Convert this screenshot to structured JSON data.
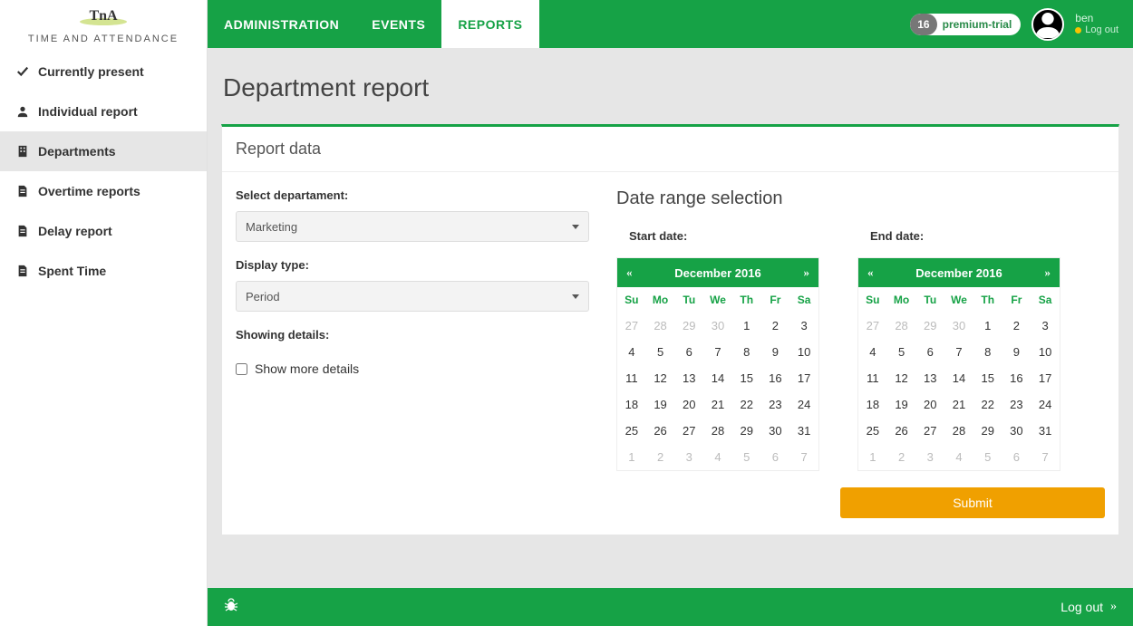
{
  "logo": {
    "main": "TnA",
    "sub": "TIME AND ATTENDANCE"
  },
  "sidebar": {
    "items": [
      {
        "label": "Currently present"
      },
      {
        "label": "Individual report"
      },
      {
        "label": "Departments"
      },
      {
        "label": "Overtime reports"
      },
      {
        "label": "Delay report"
      },
      {
        "label": "Spent Time"
      }
    ]
  },
  "topbar": {
    "tabs": [
      {
        "label": "ADMINISTRATION"
      },
      {
        "label": "EVENTS"
      },
      {
        "label": "REPORTS"
      }
    ],
    "badge_number": "16",
    "badge_label": "premium-trial",
    "username": "ben",
    "logout_label": "Log out"
  },
  "page": {
    "title": "Department report"
  },
  "panel": {
    "title": "Report data",
    "dept_label": "Select departament:",
    "dept_value": "Marketing",
    "display_label": "Display type:",
    "display_value": "Period",
    "details_label": "Showing details:",
    "checkbox_label": "Show more details",
    "date_section_title": "Date range selection",
    "start_label": "Start date:",
    "end_label": "End date:",
    "submit_label": "Submit"
  },
  "calendar": {
    "month_label": "December 2016",
    "prev": "«",
    "next": "»",
    "dow": [
      "Su",
      "Mo",
      "Tu",
      "We",
      "Th",
      "Fr",
      "Sa"
    ],
    "rows": [
      [
        {
          "d": "27",
          "m": true
        },
        {
          "d": "28",
          "m": true
        },
        {
          "d": "29",
          "m": true
        },
        {
          "d": "30",
          "m": true
        },
        {
          "d": "1"
        },
        {
          "d": "2"
        },
        {
          "d": "3"
        }
      ],
      [
        {
          "d": "4"
        },
        {
          "d": "5"
        },
        {
          "d": "6"
        },
        {
          "d": "7"
        },
        {
          "d": "8"
        },
        {
          "d": "9"
        },
        {
          "d": "10"
        }
      ],
      [
        {
          "d": "11"
        },
        {
          "d": "12"
        },
        {
          "d": "13"
        },
        {
          "d": "14"
        },
        {
          "d": "15"
        },
        {
          "d": "16"
        },
        {
          "d": "17"
        }
      ],
      [
        {
          "d": "18"
        },
        {
          "d": "19"
        },
        {
          "d": "20"
        },
        {
          "d": "21"
        },
        {
          "d": "22"
        },
        {
          "d": "23"
        },
        {
          "d": "24"
        }
      ],
      [
        {
          "d": "25"
        },
        {
          "d": "26"
        },
        {
          "d": "27"
        },
        {
          "d": "28"
        },
        {
          "d": "29"
        },
        {
          "d": "30"
        },
        {
          "d": "31"
        }
      ],
      [
        {
          "d": "1",
          "m": true
        },
        {
          "d": "2",
          "m": true
        },
        {
          "d": "3",
          "m": true
        },
        {
          "d": "4",
          "m": true
        },
        {
          "d": "5",
          "m": true
        },
        {
          "d": "6",
          "m": true
        },
        {
          "d": "7",
          "m": true
        }
      ]
    ]
  },
  "footer": {
    "logout_label": "Log out"
  }
}
